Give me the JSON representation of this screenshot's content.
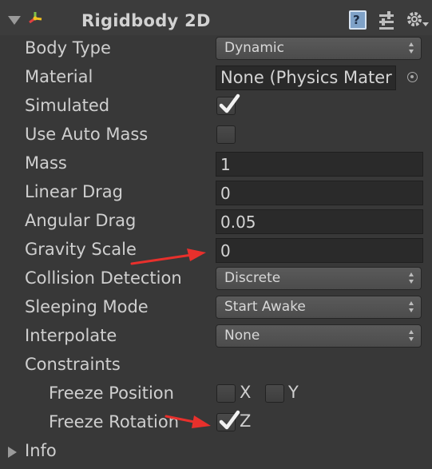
{
  "component": {
    "title": "Rigidbody 2D",
    "icons": [
      "chevron-down-icon",
      "component-enabled-icon",
      "help-icon",
      "preset-icon",
      "gear-icon"
    ]
  },
  "fields": {
    "body_type": {
      "label": "Body Type",
      "value": "Dynamic"
    },
    "material": {
      "label": "Material",
      "value": "None (Physics Mater"
    },
    "simulated": {
      "label": "Simulated",
      "checked": true
    },
    "use_auto_mass": {
      "label": "Use Auto Mass",
      "checked": false
    },
    "mass": {
      "label": "Mass",
      "value": "1"
    },
    "linear_drag": {
      "label": "Linear Drag",
      "value": "0"
    },
    "angular_drag": {
      "label": "Angular Drag",
      "value": "0.05"
    },
    "gravity_scale": {
      "label": "Gravity Scale",
      "value": "0"
    },
    "collision_detection": {
      "label": "Collision Detection",
      "value": "Discrete"
    },
    "sleeping_mode": {
      "label": "Sleeping Mode",
      "value": "Start Awake"
    },
    "interpolate": {
      "label": "Interpolate",
      "value": "None"
    }
  },
  "constraints": {
    "label": "Constraints",
    "freeze_position": {
      "label": "Freeze Position",
      "x_label": "X",
      "y_label": "Y",
      "x": false,
      "y": false
    },
    "freeze_rotation": {
      "label": "Freeze Rotation",
      "z_label": "Z",
      "z": true
    }
  },
  "info": {
    "label": "Info"
  },
  "colors": {
    "annotation_arrow": "#e8302c",
    "panel_bg": "#383838",
    "field_bg": "#2a2a2a"
  }
}
